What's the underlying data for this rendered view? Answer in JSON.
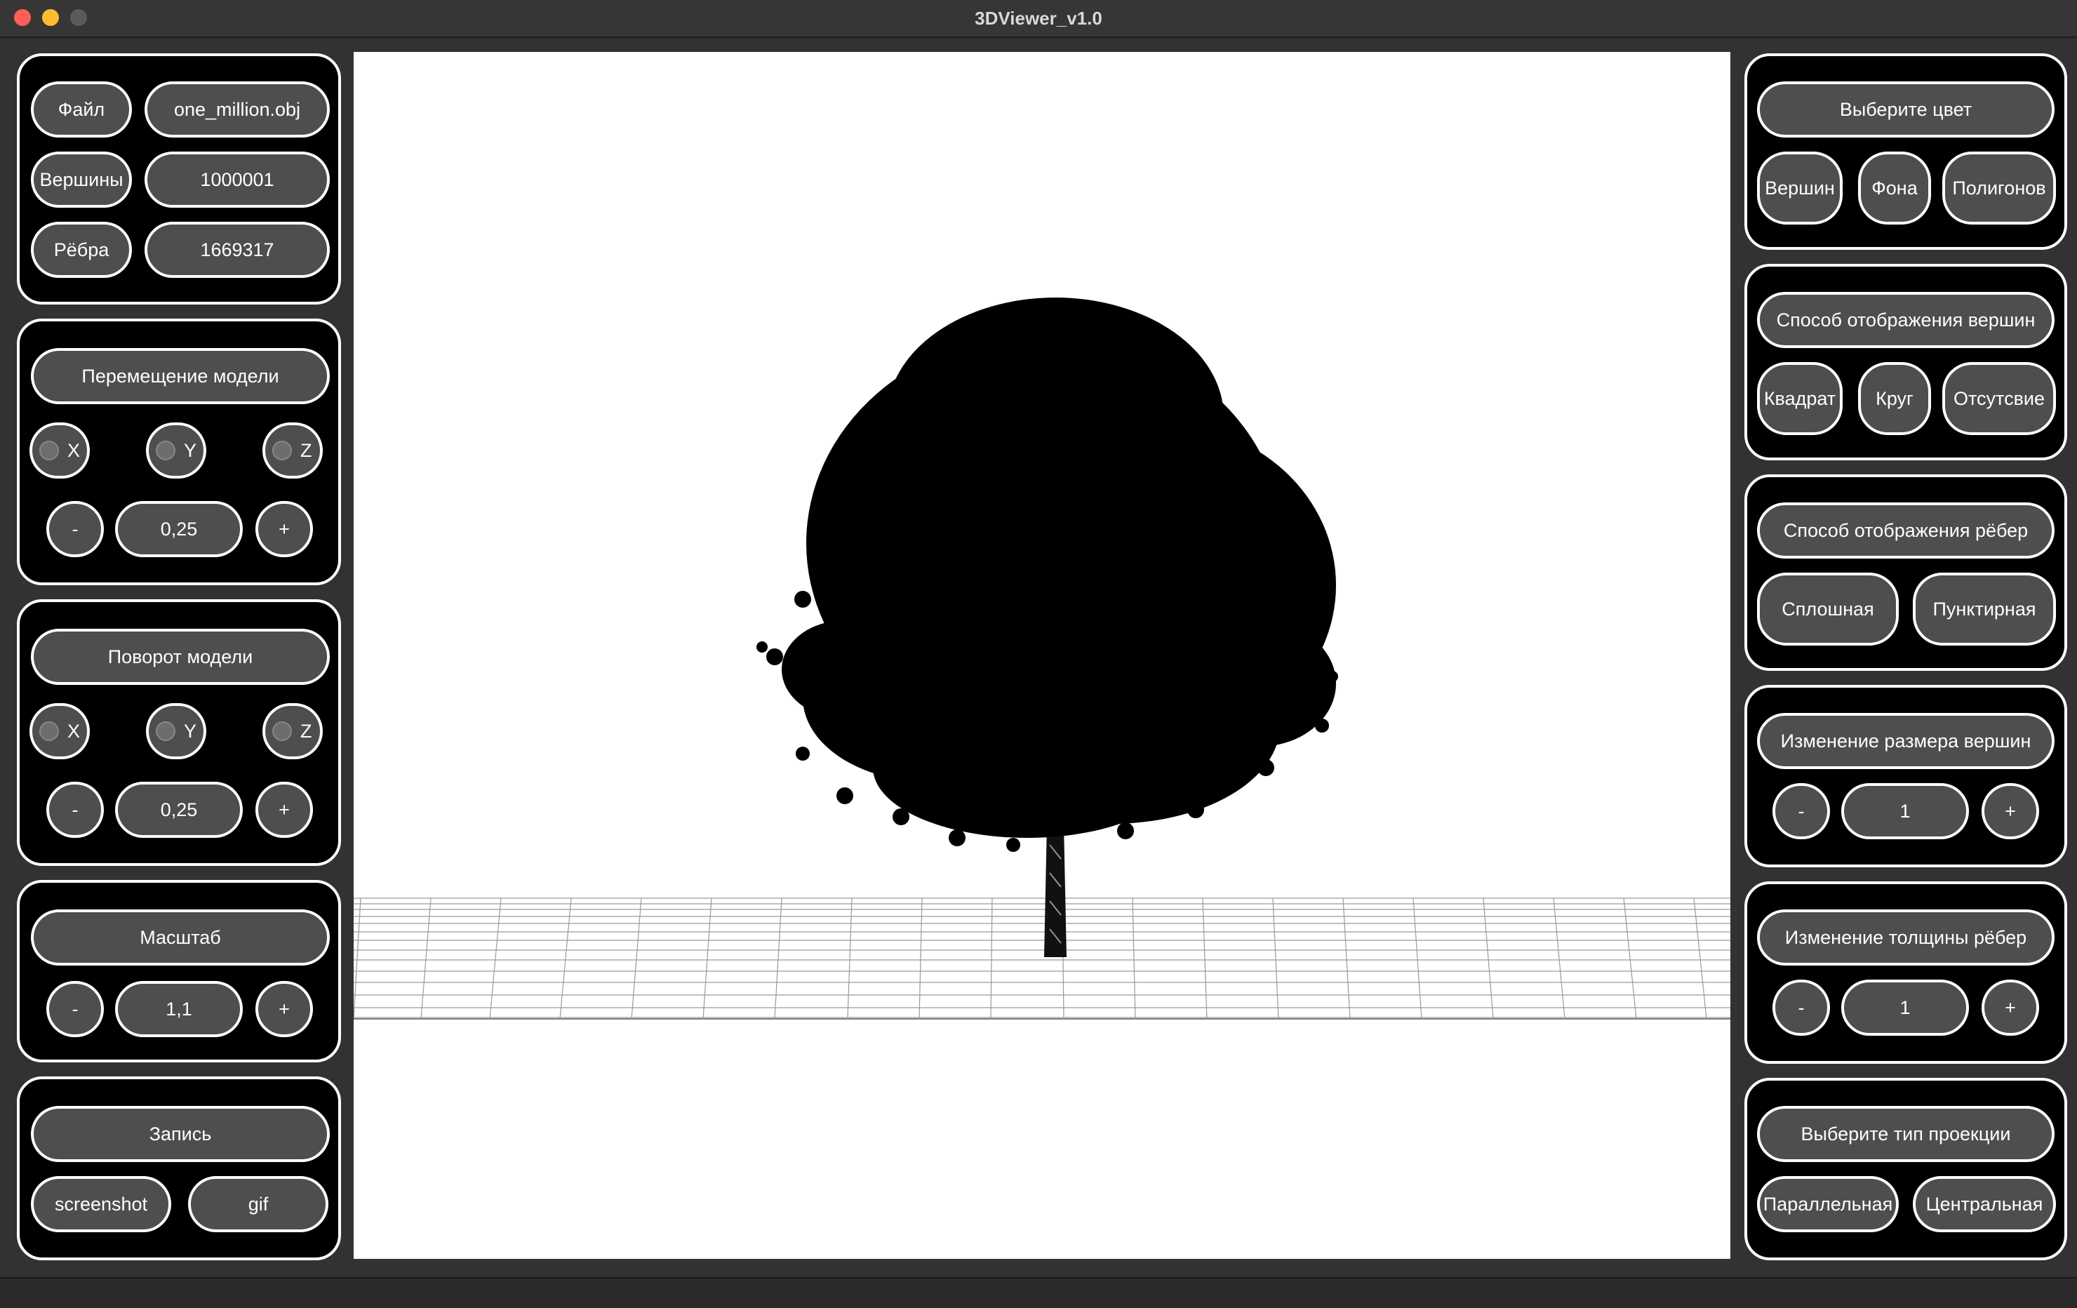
{
  "window": {
    "title": "3DViewer_v1.0"
  },
  "file_info": {
    "file_label": "Файл",
    "file_value": "one_million.obj",
    "vertices_label": "Вершины",
    "vertices_value": "1000001",
    "edges_label": "Рёбра",
    "edges_value": "1669317"
  },
  "translate": {
    "title": "Перемещение модели",
    "axes": [
      "X",
      "Y",
      "Z"
    ],
    "minus": "-",
    "value": "0,25",
    "plus": "+"
  },
  "rotate": {
    "title": "Поворот модели",
    "axes": [
      "X",
      "Y",
      "Z"
    ],
    "minus": "-",
    "value": "0,25",
    "plus": "+"
  },
  "scale": {
    "title": "Масштаб",
    "minus": "-",
    "value": "1,1",
    "plus": "+"
  },
  "record": {
    "title": "Запись",
    "screenshot": "screenshot",
    "gif": "gif"
  },
  "color": {
    "title": "Выберите цвет",
    "vertices": "Вершин",
    "background": "Фона",
    "polygons": "Полигонов"
  },
  "vertex_display": {
    "title": "Способ отображения вершин",
    "square": "Квадрат",
    "circle": "Круг",
    "none": "Отсутсвие"
  },
  "edge_display": {
    "title": "Способ отображения рёбер",
    "solid": "Сплошная",
    "dashed": "Пунктирная"
  },
  "vertex_size": {
    "title": "Изменение размера вершин",
    "minus": "-",
    "value": "1",
    "plus": "+"
  },
  "edge_width": {
    "title": "Изменение толщины рёбер",
    "minus": "-",
    "value": "1",
    "plus": "+"
  },
  "projection": {
    "title": "Выберите тип проекции",
    "parallel": "Параллельная",
    "central": "Центральная"
  },
  "viewport": {
    "background": "#ffffff",
    "model_color": "#000000"
  }
}
